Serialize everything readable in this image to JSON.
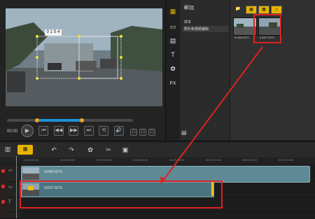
{
  "preview": {
    "label_box": "0 1 S 4",
    "timecode": "00:00",
    "controls": [
      "⏮",
      "◀◀",
      "▶▶",
      "⏭",
      "⟲",
      "🔊"
    ],
    "right_controls": [
      "□",
      "□",
      "□",
      "□"
    ]
  },
  "library": {
    "add_label": "添加",
    "folders": [
      "样本",
      "照片和视频编辑"
    ],
    "filters": [
      "📁",
      "▦",
      "▦",
      "♫"
    ],
    "thumbs": [
      {
        "name": "01460.MTS"
      },
      {
        "name": "01537.MTS"
      }
    ]
  },
  "side_icons": [
    "▦",
    "▭",
    "▤",
    "T",
    "✿",
    "FX"
  ],
  "toolbar": {
    "view_label": "▦",
    "tools": [
      "↶",
      "↷",
      "✿",
      "✂",
      "▣"
    ]
  },
  "ruler_labels": [
    "00:00:00:00",
    "00:00:02:00",
    "00:00:04:00",
    "00:00:06:00",
    "00:00:08:00",
    "00:00:10:00",
    "00:00:12:00",
    "00:00:14:00"
  ],
  "tracks": {
    "video_clip_name": "01460.MTS",
    "overlay_clip_name": "01537.MTS"
  },
  "colors": {
    "accent": "#e6b400",
    "highlight_red": "#dd2222",
    "scrubber_blue": "#1e8fd6",
    "clip_teal": "#5e8a96"
  }
}
